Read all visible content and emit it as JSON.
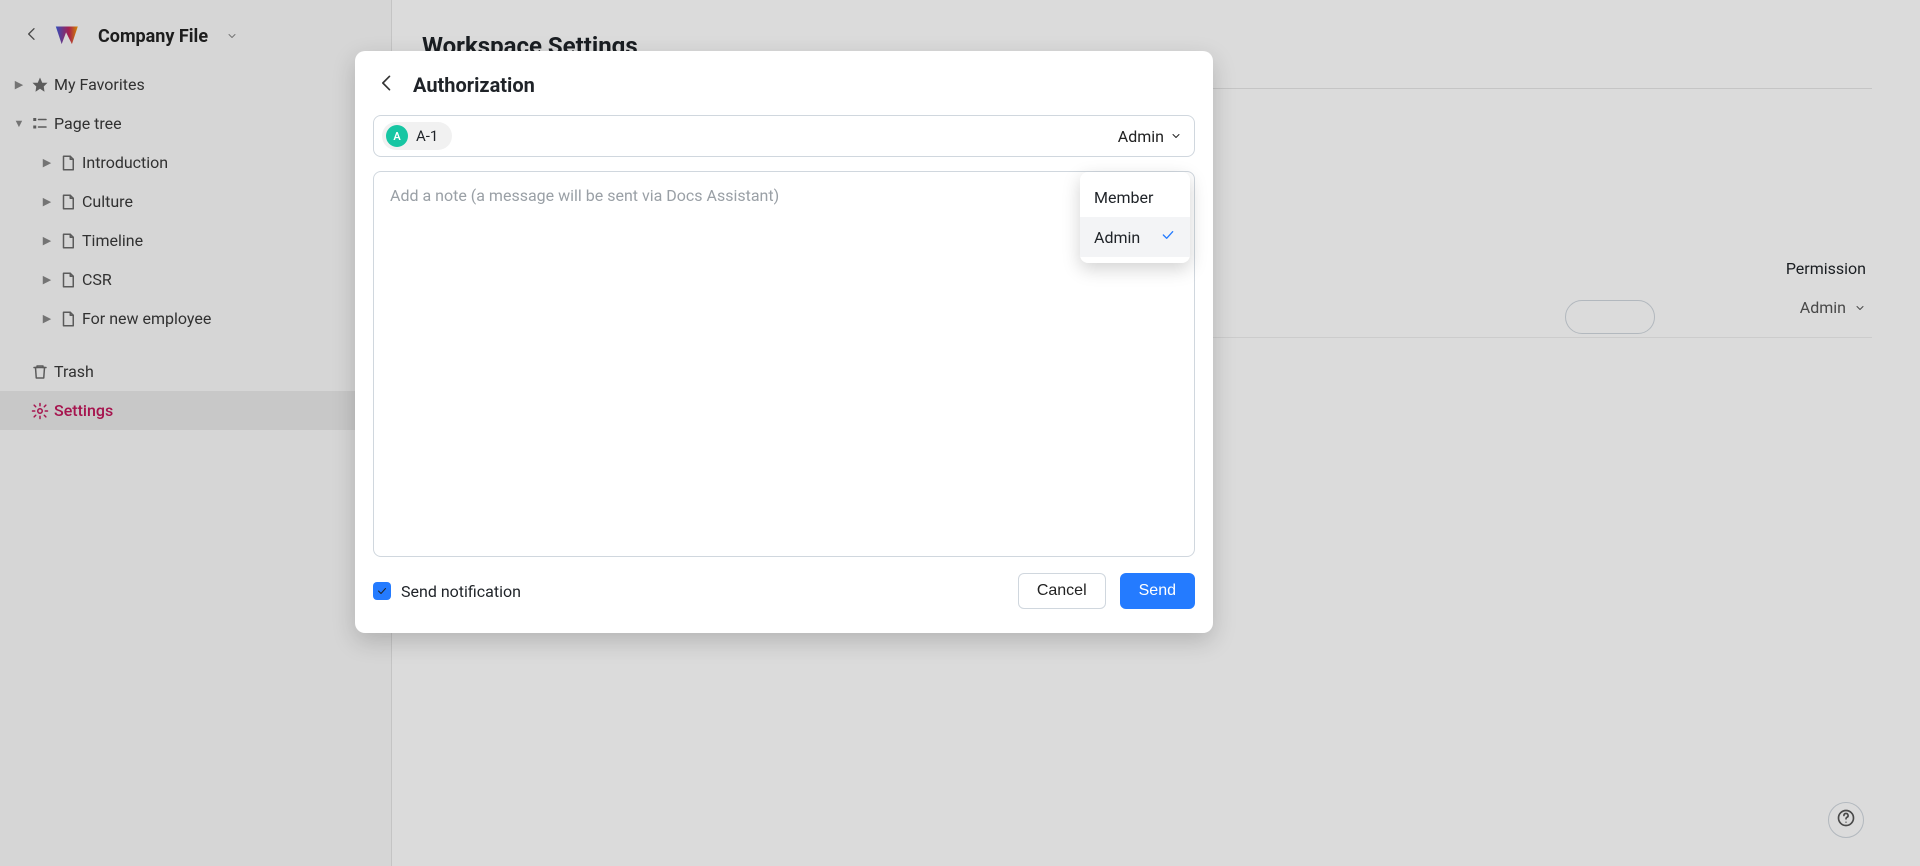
{
  "header": {
    "workspace": "Company File"
  },
  "sidebar": {
    "favorites": "My Favorites",
    "pagetree": "Page tree",
    "pages": [
      "Introduction",
      "Culture",
      "Timeline",
      "CSR",
      "For new employee"
    ],
    "trash": "Trash",
    "settings": "Settings"
  },
  "main": {
    "title": "Workspace Settings",
    "perm_header": "Permission",
    "row_role": "Admin"
  },
  "modal": {
    "title": "Authorization",
    "recipient": {
      "avatar": "A",
      "name": "A-1"
    },
    "role": "Admin",
    "note_placeholder": "Add a note (a message will be sent via Docs Assistant)",
    "notify_label": "Send notification",
    "cancel": "Cancel",
    "send": "Send"
  },
  "dropdown": {
    "options": [
      "Member",
      "Admin"
    ],
    "selected": "Admin"
  }
}
